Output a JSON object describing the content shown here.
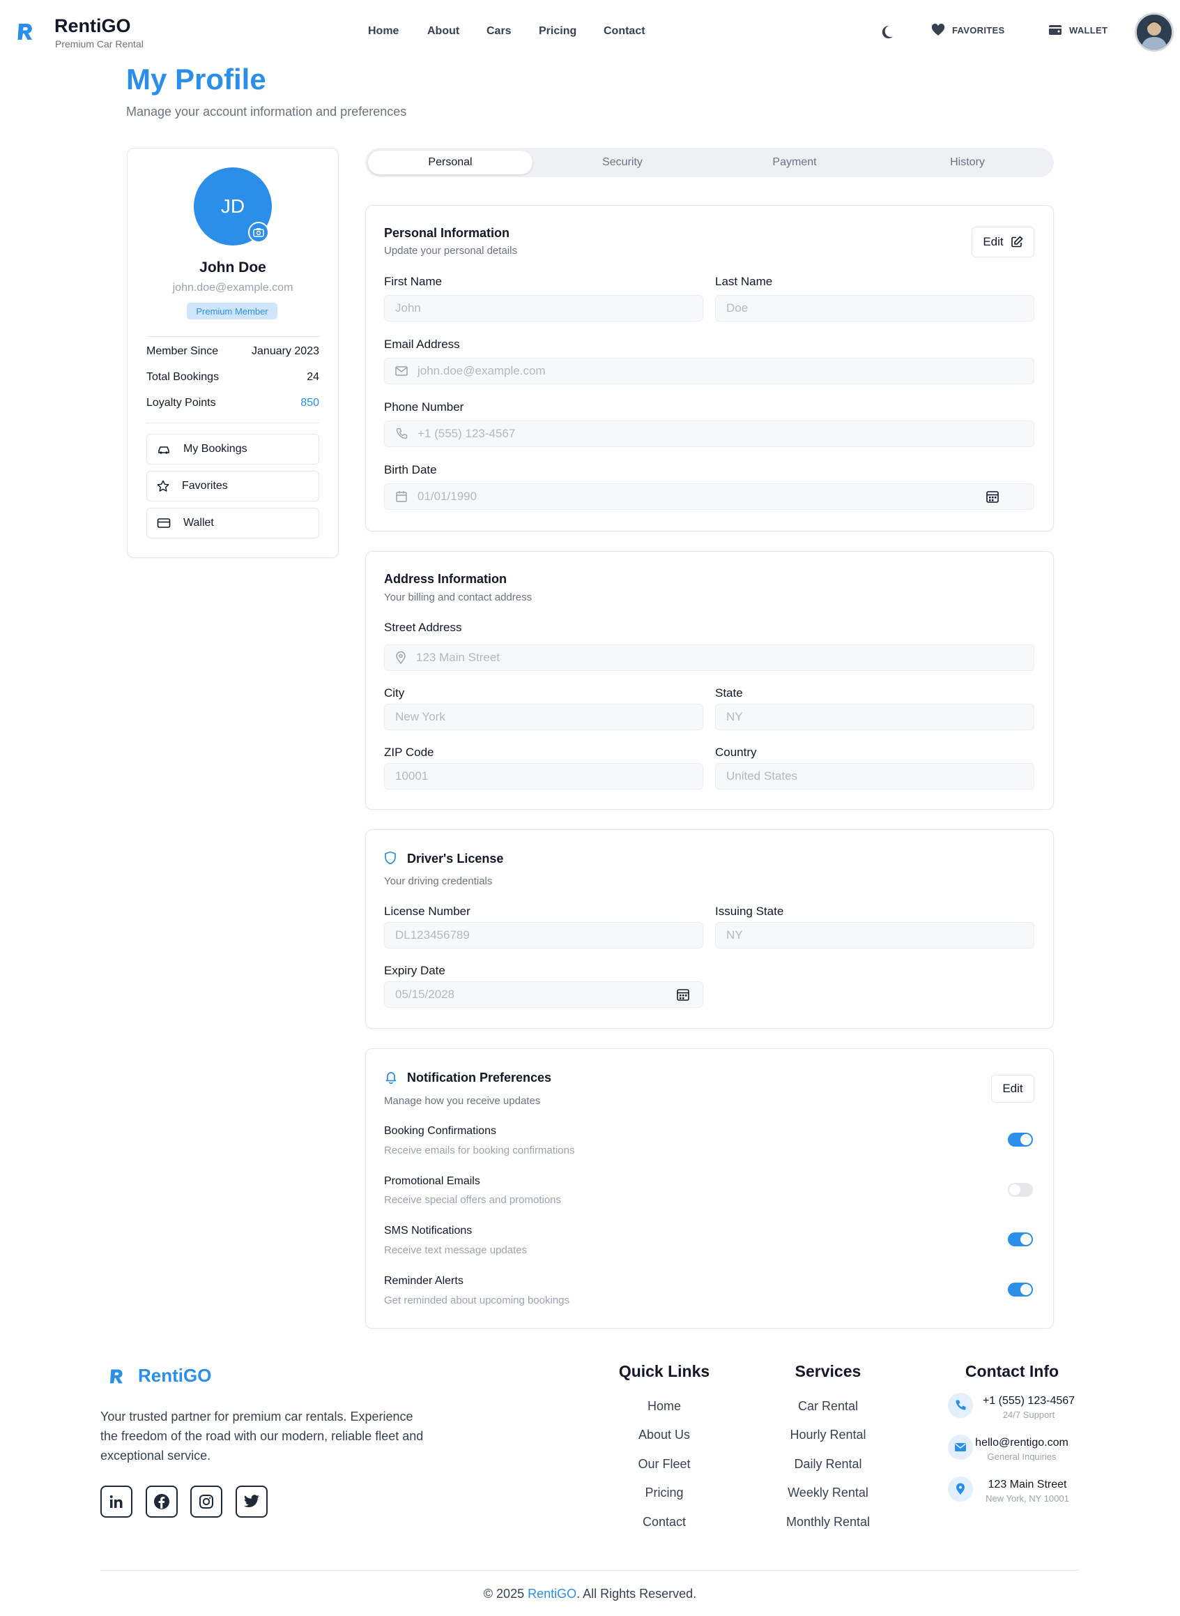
{
  "header": {
    "brand": "RentiGO",
    "tagline": "Premium Car Rental",
    "nav": [
      "Home",
      "About",
      "Cars",
      "Pricing",
      "Contact"
    ],
    "favorites_label": "FAVORITES",
    "wallet_label": "WALLET"
  },
  "page": {
    "title": "My Profile",
    "subtitle": "Manage your account information and preferences"
  },
  "profile": {
    "initials": "JD",
    "name": "John Doe",
    "email": "john.doe@example.com",
    "badge": "Premium Member",
    "stats": [
      {
        "label": "Member Since",
        "value": "January 2023"
      },
      {
        "label": "Total Bookings",
        "value": "24"
      },
      {
        "label": "Loyalty Points",
        "value": "850"
      }
    ],
    "menu": [
      "My Bookings",
      "Favorites",
      "Wallet"
    ]
  },
  "tabs": [
    "Personal",
    "Security",
    "Payment",
    "History"
  ],
  "personal": {
    "title": "Personal Information",
    "subtitle": "Update your personal details",
    "edit_label": "Edit",
    "first_name_label": "First Name",
    "first_name": "John",
    "last_name_label": "Last Name",
    "last_name": "Doe",
    "email_label": "Email Address",
    "email": "john.doe@example.com",
    "phone_label": "Phone Number",
    "phone": "+1 (555) 123-4567",
    "birth_label": "Birth Date",
    "birth": "01/01/1990"
  },
  "address": {
    "title": "Address Information",
    "subtitle": "Your billing and contact address",
    "street_label": "Street Address",
    "street": "123 Main Street",
    "city_label": "City",
    "city": "New York",
    "state_label": "State",
    "state": "NY",
    "zip_label": "ZIP Code",
    "zip": "10001",
    "country_label": "Country",
    "country": "United States"
  },
  "license": {
    "title": "Driver's License",
    "subtitle": "Your driving credentials",
    "number_label": "License Number",
    "number": "DL123456789",
    "state_label": "Issuing State",
    "state": "NY",
    "expiry_label": "Expiry Date",
    "expiry": "05/15/2028"
  },
  "notifications": {
    "title": "Notification Preferences",
    "subtitle": "Manage how you receive updates",
    "edit_label": "Edit",
    "items": [
      {
        "title": "Booking Confirmations",
        "desc": "Receive emails for booking confirmations",
        "on": true
      },
      {
        "title": "Promotional Emails",
        "desc": "Receive special offers and promotions",
        "on": false
      },
      {
        "title": "SMS Notifications",
        "desc": "Receive text message updates",
        "on": true
      },
      {
        "title": "Reminder Alerts",
        "desc": "Get reminded about upcoming bookings",
        "on": true
      }
    ]
  },
  "footer": {
    "brand": "RentiGO",
    "description": "Your trusted partner for premium car rentals. Experience the freedom of the road with our modern, reliable fleet and exceptional service.",
    "quick_links_title": "Quick Links",
    "quick_links": [
      "Home",
      "About Us",
      "Our Fleet",
      "Pricing",
      "Contact"
    ],
    "services_title": "Services",
    "services": [
      "Car Rental",
      "Hourly Rental",
      "Daily Rental",
      "Weekly Rental",
      "Monthly Rental"
    ],
    "contact_title": "Contact Info",
    "contacts": [
      {
        "main": "+1 (555) 123-4567",
        "sub": "24/7 Support"
      },
      {
        "main": "hello@rentigo.com",
        "sub": "General Inquiries"
      },
      {
        "main": "123 Main Street",
        "sub": "New York, NY 10001"
      }
    ],
    "copyright_prefix": "© 2025 ",
    "copyright_brand": "RentiGO",
    "copyright_suffix": ". All Rights Reserved."
  },
  "colors": {
    "accent": "#2b8ee8",
    "text": "#111827",
    "muted": "#6b7280"
  }
}
